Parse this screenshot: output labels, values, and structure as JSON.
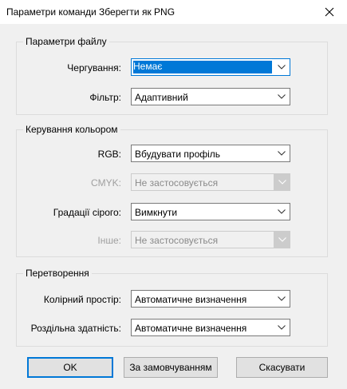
{
  "window": {
    "title": "Параметри команди Зберегти як PNG"
  },
  "file_options": {
    "legend": "Параметри файлу",
    "interlace": {
      "label": "Чергування:",
      "value": "Немає"
    },
    "filter": {
      "label": "Фільтр:",
      "value": "Адаптивний"
    }
  },
  "color_management": {
    "legend": "Керування кольором",
    "rgb": {
      "label": "RGB:",
      "value": "Вбудувати профіль"
    },
    "cmyk": {
      "label": "CMYK:",
      "value": "Не застосовується"
    },
    "gray": {
      "label": "Градації сірого:",
      "value": "Вимкнути"
    },
    "other": {
      "label": "Інше:",
      "value": "Не застосовується"
    }
  },
  "conversion": {
    "legend": "Перетворення",
    "color_space": {
      "label": "Колірний простір:",
      "value": "Автоматичне визначення"
    },
    "resolution": {
      "label": "Роздільна здатність:",
      "value": "Автоматичне визначення"
    }
  },
  "buttons": {
    "ok": "OK",
    "defaults": "За замовчуванням",
    "cancel": "Скасувати"
  },
  "colors": {
    "accent": "#0078d7",
    "background": "#f0f0f0",
    "disabled_text": "#a0a0a0"
  },
  "icons": {
    "close": "close-icon",
    "dropdown": "chevron-down-icon"
  }
}
